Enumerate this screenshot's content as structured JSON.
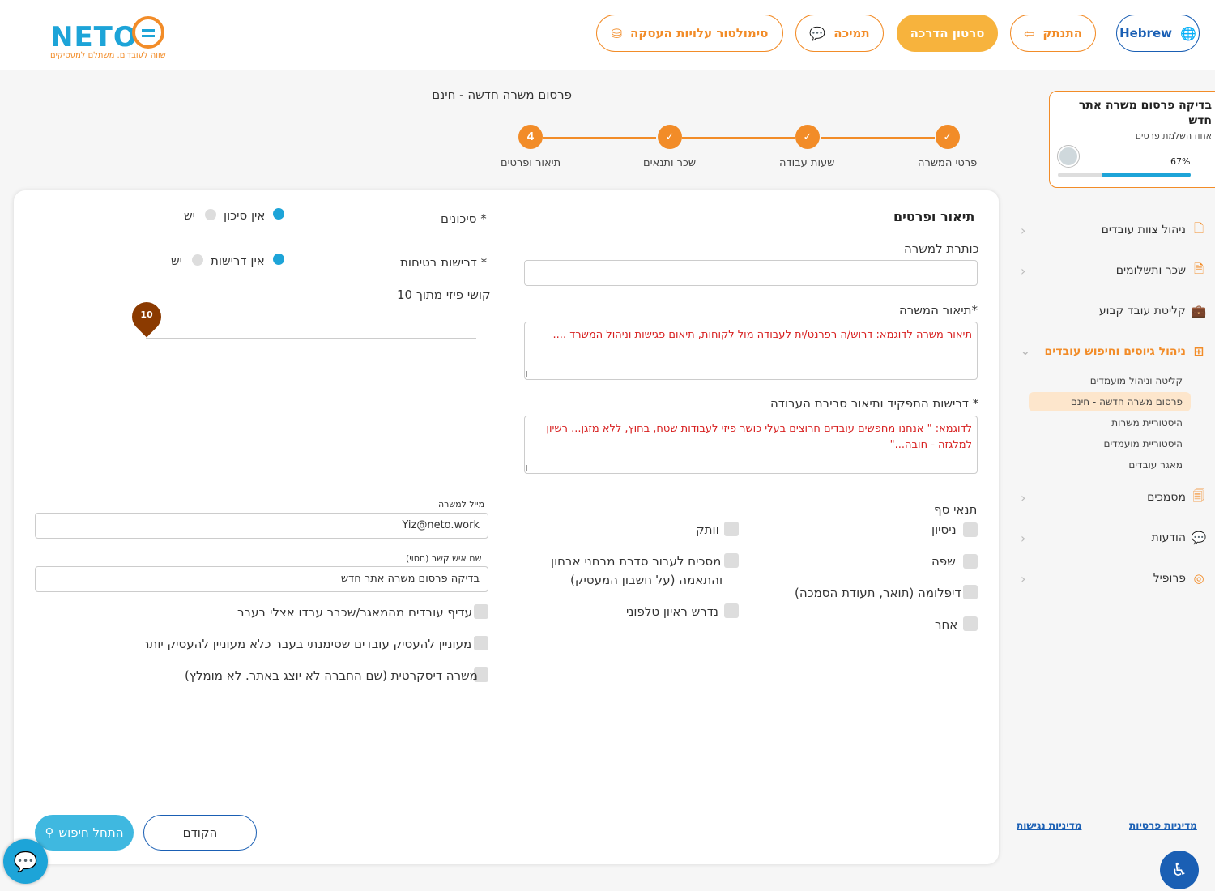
{
  "header": {
    "logo_text": "NETO",
    "logo_tagline": "שווה לעובדים. משתלם למעסיקים",
    "language_label": "Hebrew",
    "logout_label": "התנתק",
    "tutorial_label": "סרטון הדרכה",
    "support_label": "תמיכה",
    "simulator_label": "סימולטור עלויות העסקה"
  },
  "sidebar": {
    "card_title": "בדיקה פרסום משרה אתר חדש",
    "card_subtitle": "אחוז השלמת פרטים",
    "progress_text": "67%",
    "progress": 0.67,
    "items": [
      {
        "label": "ניהול צוות עובדים",
        "icon": "document-icon"
      },
      {
        "label": "שכר ותשלומים",
        "icon": "payroll-icon"
      },
      {
        "label": "קליטת עובד קבוע",
        "icon": "briefcase-icon"
      },
      {
        "label": "ניהול גיוסים וחיפוש עובדים",
        "icon": "recruit-icon"
      },
      {
        "label": "מסמכים",
        "icon": "documents-icon"
      },
      {
        "label": "הודעות",
        "icon": "chat-icon"
      },
      {
        "label": "פרופיל",
        "icon": "profile-icon"
      }
    ],
    "sub_items": [
      {
        "label": "קליטה וניהול מועמדים"
      },
      {
        "label": "פרסום משרה חדשה - חינם"
      },
      {
        "label": "היסטוריית משרות"
      },
      {
        "label": "היסטוריית מועמדים"
      },
      {
        "label": "מאגר עובדים"
      }
    ],
    "privacy_policy": "מדיניות פרטיות",
    "accessibility_policy": "מדיניות נגישות"
  },
  "page": {
    "title": "פרסום משרה חדשה - חינם",
    "steps": [
      {
        "label": "פרטי המשרה",
        "mark": "✓"
      },
      {
        "label": "שעות עבודה",
        "mark": "✓"
      },
      {
        "label": "שכר ותנאים",
        "mark": "✓"
      },
      {
        "label": "תיאור ופרטים",
        "mark": "4"
      }
    ]
  },
  "form": {
    "section_title": "תיאור ופרטים",
    "job_title_label": "כותרת למשרה",
    "job_title_value": "",
    "description_label": "*תיאור המשרה",
    "description_placeholder": "תיאור משרה לדוגמא: דרוש/ה רפרנט/ית לעבודה מול לקוחות, תיאום פגישות וניהול המשרד ....",
    "requirements_label": "* דרישות התפקיד ותיאור סביבת העבודה",
    "requirements_placeholder_line1": "לדוגמא: \" אנחנו מחפשים עובדים חרוצים בעלי כושר פיזי לעבודות שטח, בחוץ, ללא מזגן... רשיון",
    "requirements_placeholder_line2": "למלגזה - חובה...\"",
    "risks_label": "* סיכונים",
    "risks_option_no": "אין סיכון",
    "risks_option_yes": "יש",
    "safety_label": "* דרישות בטיחות",
    "safety_option_no": "אין דרישות",
    "safety_option_yes": "יש",
    "difficulty_label": "קושי פיזי מתוך 10",
    "difficulty_value": "10",
    "threshold_label": "תנאי סף",
    "threshold_options": [
      "ניסיון",
      "שפה",
      "דיפלומה (תואר, תעודת הסמכה)",
      "אחר"
    ],
    "middle_options": [
      "וותק",
      "מסכים לעבור סדרת מבחני אבחון",
      "והתאמה (על חשבון המעסיק)",
      "נדרש ראיון טלפוני"
    ],
    "email_label": "מייל למשרה",
    "email_value": "Yiz@neto.work",
    "contact_label": "שם איש קשר (חסוי)",
    "contact_value": "בדיקה פרסום משרה אתר חדש",
    "pref_options": [
      "עדיף עובדים מהמאגר/שכבר עבדו אצלי בעבר",
      "מעוניין להעסיק עובדים שסימנתי בעבר כלא מעוניין להעסיק יותר",
      "משרה דיסקרטית (שם החברה לא יוצג באתר. לא מומלץ)"
    ],
    "prev_button": "הקודם",
    "search_button": "התחל חיפוש"
  },
  "colors": {
    "brand_orange": "#f28c28",
    "brand_blue": "#1da4d8",
    "link_blue": "#1a5fb4",
    "hint_red": "#d71f1f"
  }
}
